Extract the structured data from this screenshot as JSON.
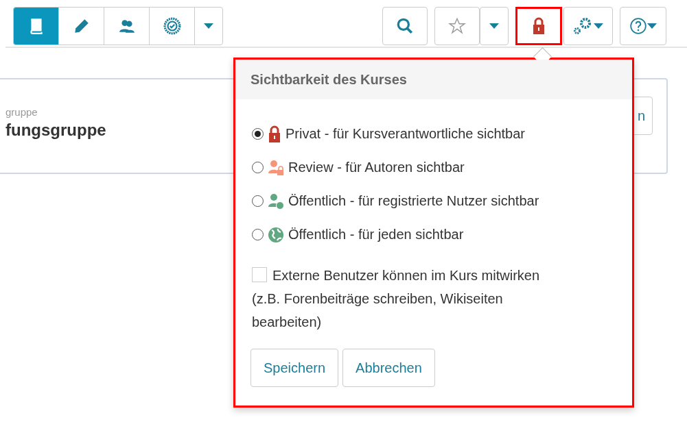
{
  "toolbar": {
    "left_buttons": [
      {
        "kind": "book",
        "selected": true
      },
      {
        "kind": "pencil",
        "selected": false
      },
      {
        "kind": "users",
        "selected": false
      },
      {
        "kind": "badge",
        "selected": false
      },
      {
        "kind": "caret",
        "selected": false
      }
    ],
    "right_buttons": [
      {
        "kind": "search",
        "highlighted": false
      },
      {
        "kind": "star",
        "highlighted": false
      },
      {
        "kind": "caret",
        "highlighted": false
      },
      {
        "kind": "lock",
        "highlighted": true
      },
      {
        "kind": "gears",
        "highlighted": false
      },
      {
        "kind": "help",
        "highlighted": false
      }
    ]
  },
  "card": {
    "label": "gruppe",
    "title": "fungsgruppe",
    "button": "n"
  },
  "popover": {
    "title": "Sichtbarkeit des Kurses",
    "options": [
      {
        "kind": "lock",
        "label": "Privat - für Kursverantwortliche sichtbar",
        "selected": true
      },
      {
        "kind": "author",
        "label": "Review - für Autoren sichtbar",
        "selected": false
      },
      {
        "kind": "user-globe",
        "label": "Öffentlich - für registrierte Nutzer sichtbar",
        "selected": false
      },
      {
        "kind": "globe",
        "label": "Öffentlich - für jeden sichtbar",
        "selected": false
      }
    ],
    "checkbox": {
      "label": "Externe Benutzer können im Kurs mitwirken (z.B. Forenbeiträge schreiben, Wikiseiten bearbeiten)",
      "checked": false
    },
    "buttons": [
      "Speichern",
      "Abbrechen"
    ]
  }
}
